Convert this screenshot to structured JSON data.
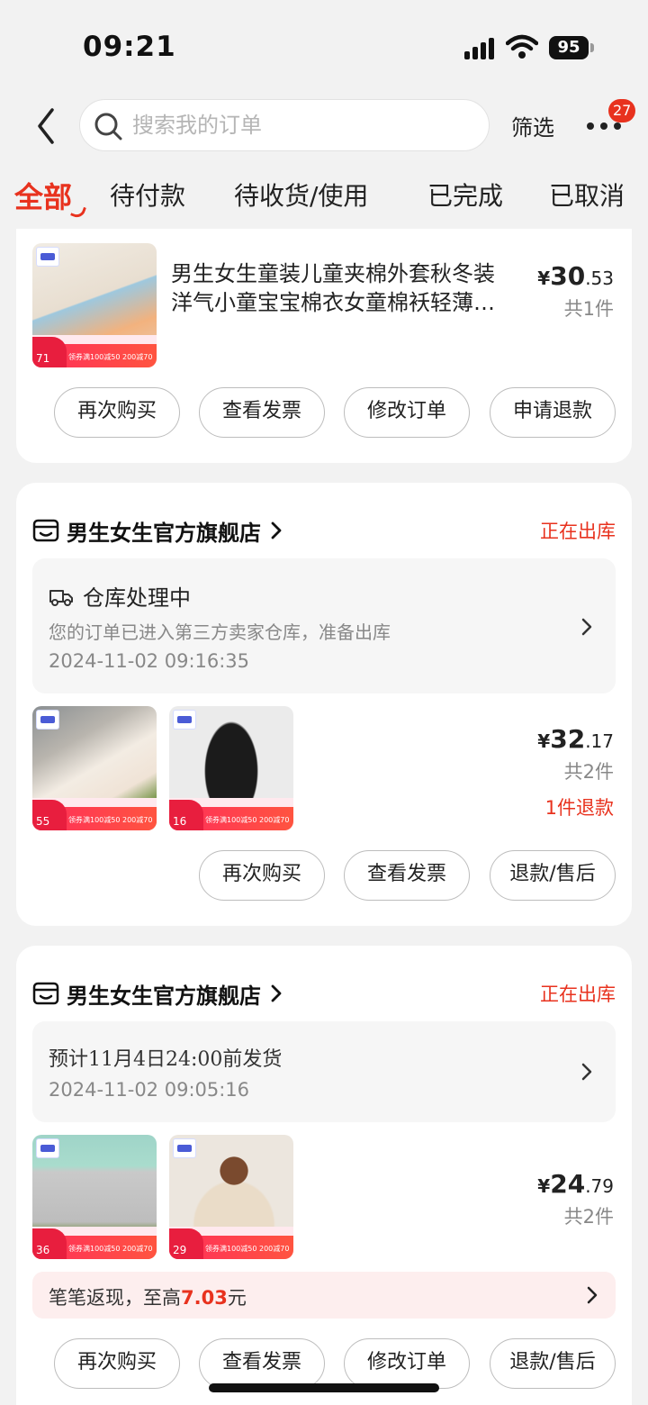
{
  "status_bar": {
    "time": "09:21",
    "battery": "95"
  },
  "header": {
    "search_placeholder": "搜索我的订单",
    "filter_label": "筛选",
    "message_badge": "27"
  },
  "tabs": [
    {
      "label": "全部",
      "active": true
    },
    {
      "label": "待付款"
    },
    {
      "label": "待收货/使用"
    },
    {
      "label": "已完成"
    },
    {
      "label": "已取消"
    }
  ],
  "orders": [
    {
      "product_title_line1": "男生女生童装儿童夹棉外套秋冬装",
      "product_title_line2": "洋气小童宝宝棉衣女童棉袄轻薄…",
      "price_currency": "¥",
      "price_int": "30",
      "price_dec": ".53",
      "quantity": "共1件",
      "thumbs": [
        {
          "price": "71",
          "promo": "领券满100减50 200减70"
        }
      ],
      "buttons": [
        "再次购买",
        "查看发票",
        "修改订单",
        "申请退款"
      ]
    },
    {
      "shop_name": "男生女生官方旗舰店",
      "status": "正在出库",
      "logistics_title": "仓库处理中",
      "logistics_desc": "您的订单已进入第三方卖家仓库，准备出库",
      "logistics_time": "2024-11-02 09:16:35",
      "price_currency": "¥",
      "price_int": "32",
      "price_dec": ".17",
      "quantity": "共2件",
      "refund_note": "1件退款",
      "thumbs": [
        {
          "price": "55",
          "promo": "领券满100减50 200减70"
        },
        {
          "price": "16",
          "promo": "领券满100减50 200减70"
        }
      ],
      "buttons": [
        "再次购买",
        "查看发票",
        "退款/售后"
      ]
    },
    {
      "shop_name": "男生女生官方旗舰店",
      "status": "正在出库",
      "logistics_title": "预计11月4日24:00前发货",
      "logistics_time": "2024-11-02 09:05:16",
      "price_currency": "¥",
      "price_int": "24",
      "price_dec": ".79",
      "quantity": "共2件",
      "thumbs": [
        {
          "price": "36",
          "promo": "领券满100减50 200减70"
        },
        {
          "price": "29",
          "promo": "领券满100减50 200减70"
        }
      ],
      "cashback_prefix": "笔笔返现，至高",
      "cashback_amount": "7.03",
      "cashback_suffix": "元",
      "buttons": [
        "再次购买",
        "查看发票",
        "修改订单",
        "退款/售后"
      ]
    }
  ],
  "colors": {
    "accent": "#e8321e",
    "background": "#f2f2f2",
    "card": "#ffffff"
  }
}
